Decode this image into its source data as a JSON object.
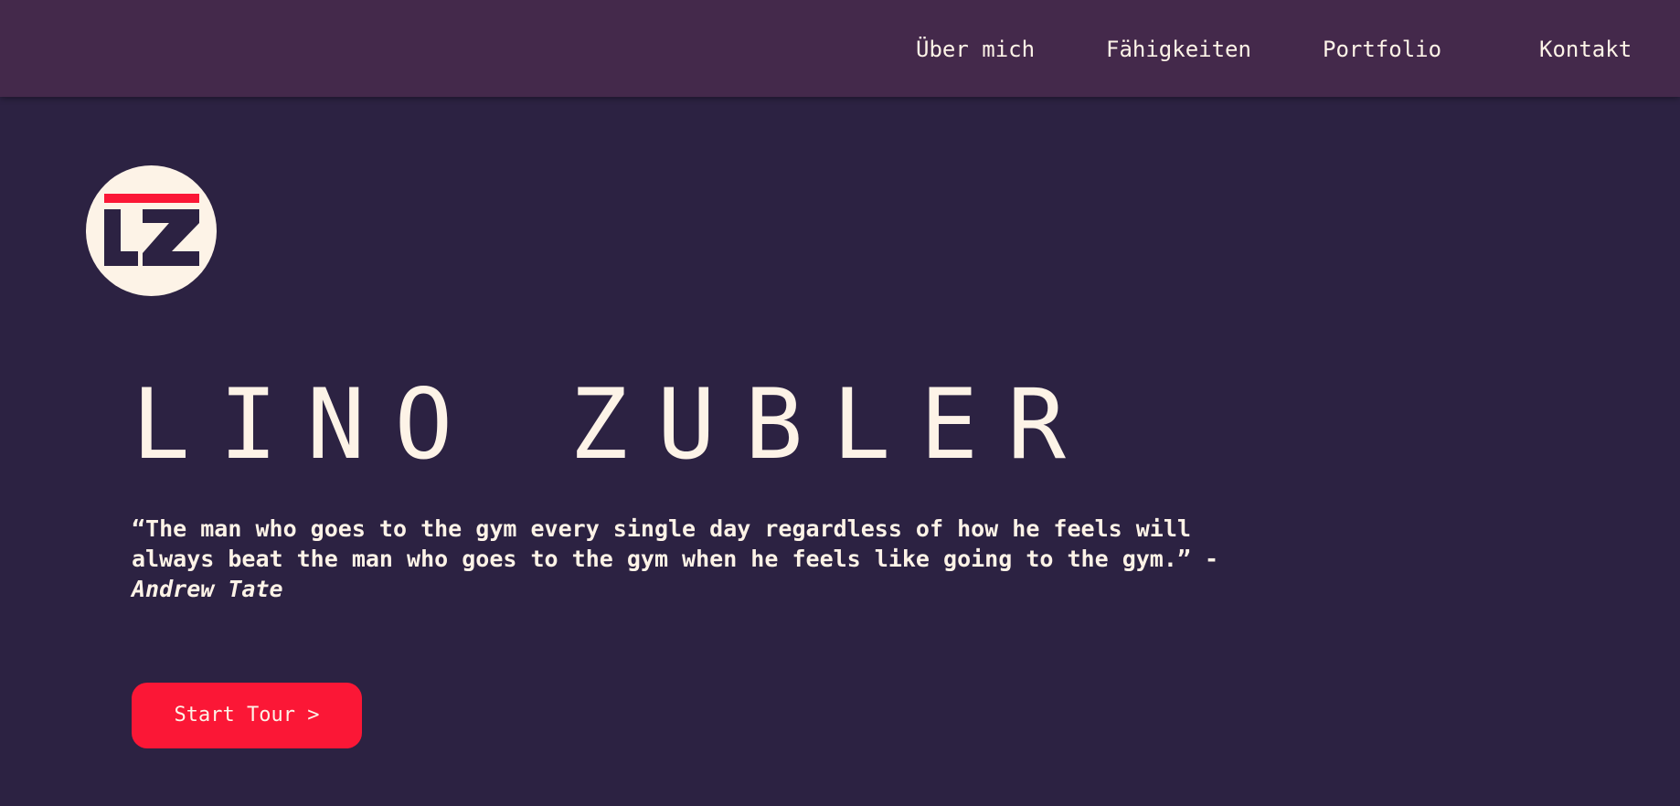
{
  "nav": {
    "items": [
      {
        "label": "Über mich"
      },
      {
        "label": "Fähigkeiten"
      },
      {
        "label": "Portfolio"
      },
      {
        "label": "Kontakt"
      }
    ]
  },
  "logo": {
    "text": "LZ",
    "icon": "lz-monogram-icon"
  },
  "hero": {
    "title": "LINO ZUBLER",
    "quote": {
      "text": "“The man who goes to the gym every single day regardless of how he feels will always beat the man who goes to the gym when he feels like going to the gym.” - ",
      "author": "Andrew Tate"
    },
    "cta_label": "Start Tour >"
  },
  "colors": {
    "background": "#2c2242",
    "navbar": "#44294b",
    "text": "#fdf3e7",
    "accent": "#fb1736",
    "logo_circle": "#fdf3e7",
    "logo_letters": "#2c2242"
  }
}
